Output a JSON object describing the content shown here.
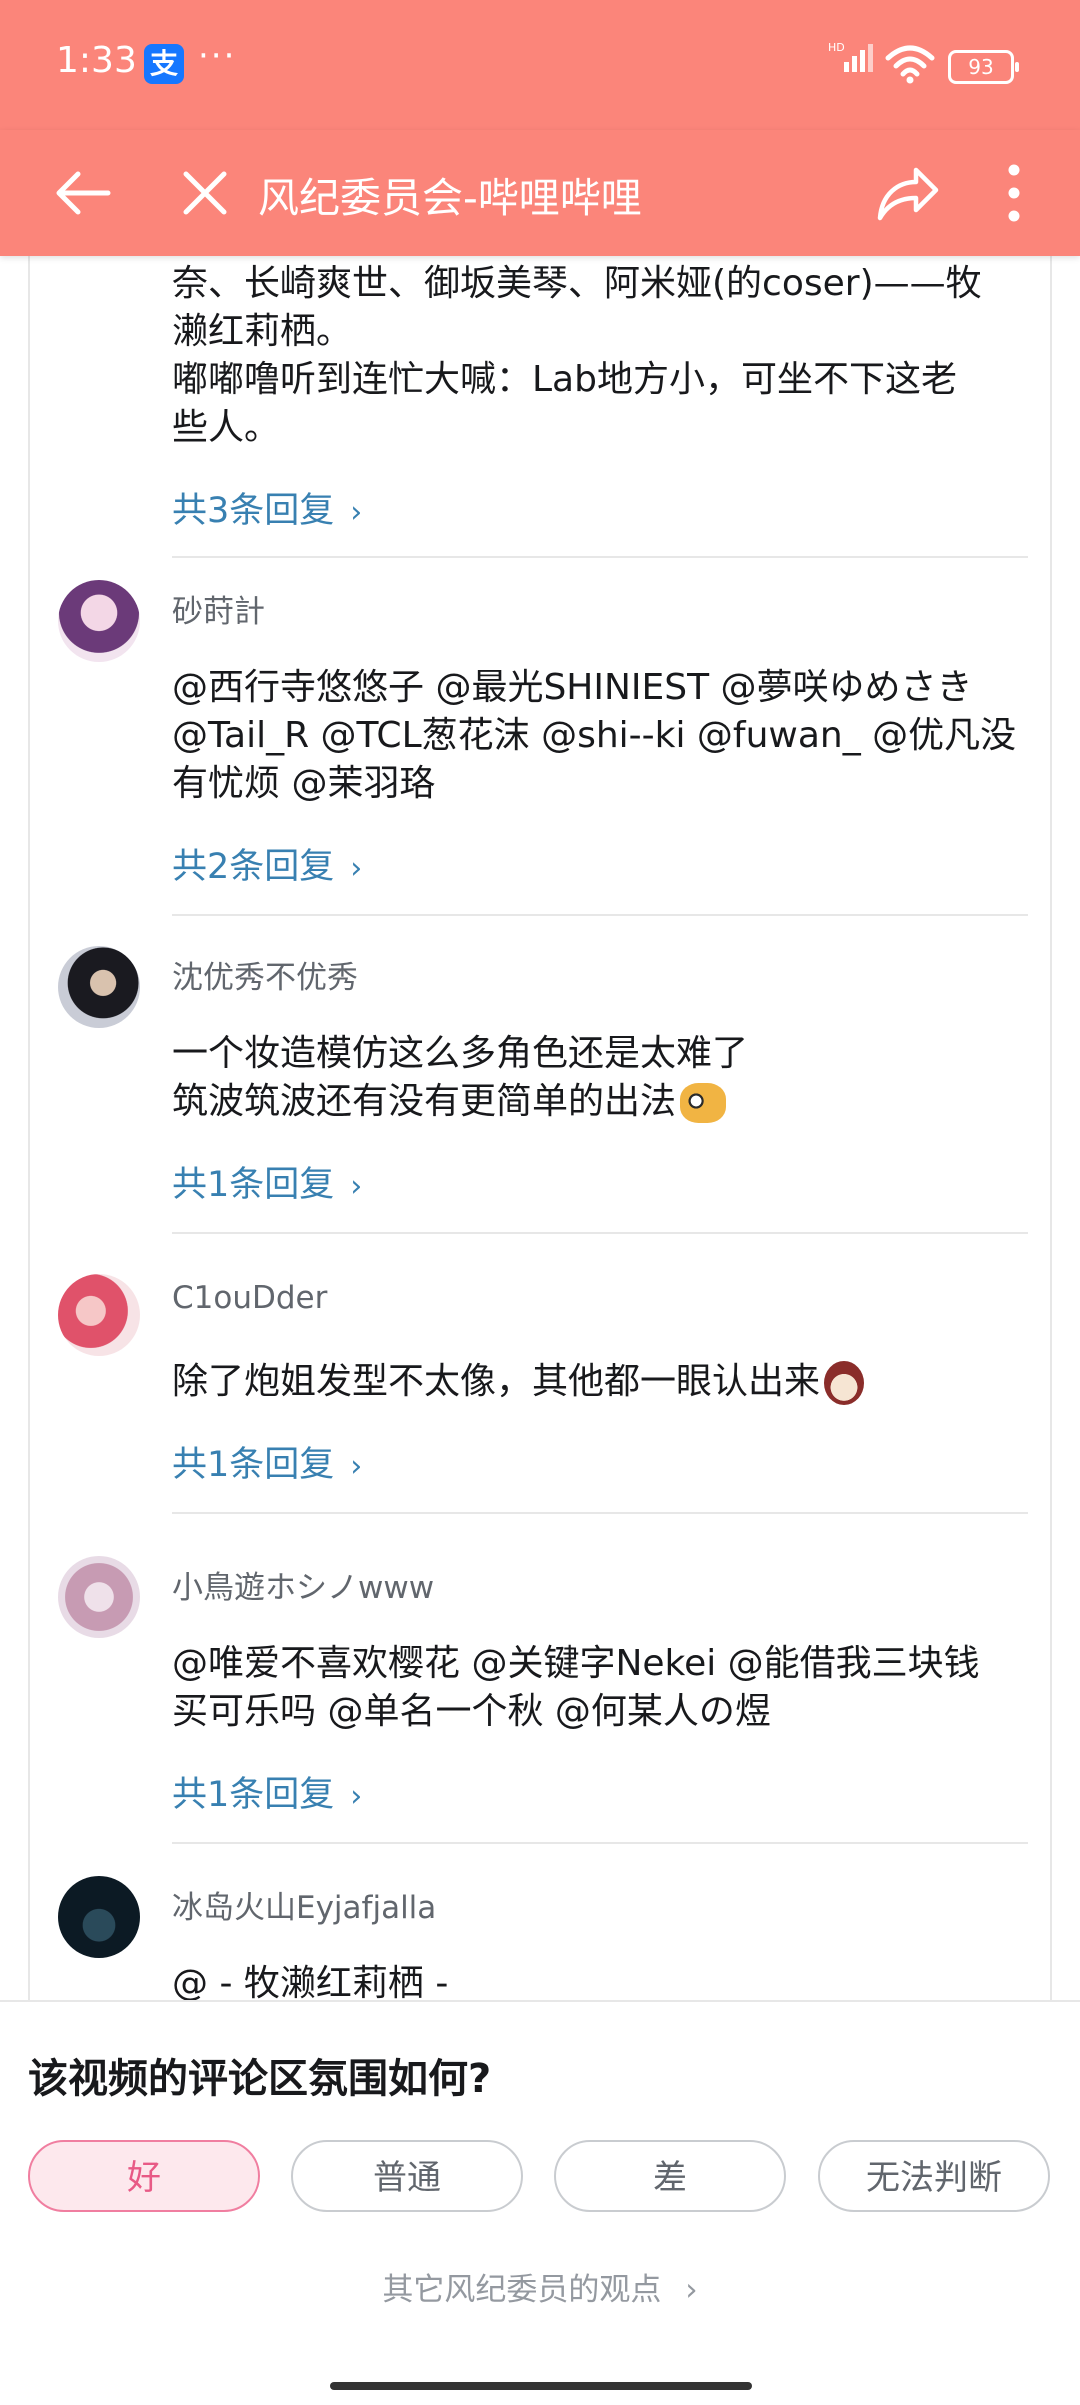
{
  "status_bar": {
    "time": "1:33",
    "pay_icon": "支",
    "dots": "···",
    "network": "HD",
    "battery": "93"
  },
  "title_bar": {
    "title": "风纪委员会-哔哩哔哩"
  },
  "top_comment": {
    "lines": [
      "奈、长崎爽世、御坂美琴、阿米娅(的coser)——牧",
      "濑红莉栖。",
      "嘟嘟噜听到连忙大喊：Lab地方小，可坐不下这老",
      "些人。"
    ],
    "replies": "共3条回复"
  },
  "comments": [
    {
      "username": "砂莳計",
      "lines": [
        "@西行寺悠悠子 @最光SHINIEST @夢咲ゆめさき",
        "@Tail_R @TCL葱花沫 @shi--ki @fuwan_ @优凡没",
        "有忧烦 @茉羽珞"
      ],
      "replies": "共2条回复"
    },
    {
      "username": "沈优秀不优秀",
      "lines": [
        "一个妆造模仿这么多角色还是太难了",
        "筑波筑波还有没有更简单的出法"
      ],
      "replies": "共1条回复"
    },
    {
      "username": "C1ouDder",
      "lines": [
        "除了炮姐发型不太像，其他都一眼认出来"
      ],
      "replies": "共1条回复"
    },
    {
      "username": "小鳥遊ホシノwww",
      "lines": [
        "@唯爱不喜欢樱花 @关键字Nekei @能借我三块钱",
        "买可乐吗 @单名一个秋 @何某人の煜"
      ],
      "replies": "共1条回复"
    },
    {
      "username": "冰岛火山Eyjafjalla",
      "lines": [
        "@ - 牧濑红莉栖 -"
      ]
    }
  ],
  "survey": {
    "question": "该视频的评论区氛围如何?",
    "options": [
      "好",
      "普通",
      "差",
      "无法判断"
    ],
    "selected": "好",
    "others_link": "其它风纪委员的观点"
  },
  "colors": {
    "header": "#fb857a",
    "link": "#3880b1",
    "selected": "#e85a86"
  }
}
